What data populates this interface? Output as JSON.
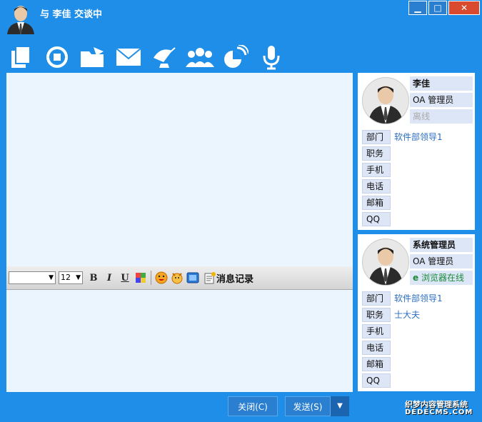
{
  "title": "与 李佳 交谈中",
  "window_buttons": {
    "minimize": "▁",
    "maximize": "□",
    "close": "✕"
  },
  "toolbar": [
    {
      "icon": "file-transfer-icon"
    },
    {
      "icon": "remote-assist-icon"
    },
    {
      "icon": "folder-share-icon"
    },
    {
      "icon": "mail-icon"
    },
    {
      "icon": "satellite-icon"
    },
    {
      "icon": "group-icon"
    },
    {
      "icon": "chart-icon"
    },
    {
      "icon": "microphone-icon"
    }
  ],
  "format_bar": {
    "font_value": "",
    "size_value": "12",
    "bold": "B",
    "italic": "I",
    "underline": "U",
    "history": "消息记录"
  },
  "contact": {
    "name": "李佳",
    "role": "OA 管理员",
    "status": "离线",
    "fields": [
      {
        "label": "部门",
        "value": "软件部领导1"
      },
      {
        "label": "职务",
        "value": ""
      },
      {
        "label": "手机",
        "value": ""
      },
      {
        "label": "电话",
        "value": ""
      },
      {
        "label": "邮箱",
        "value": ""
      },
      {
        "label": "QQ",
        "value": ""
      }
    ]
  },
  "self": {
    "name": "系统管理员",
    "role": "OA 管理员",
    "status": "浏览器在线",
    "fields": [
      {
        "label": "部门",
        "value": "软件部领导1"
      },
      {
        "label": "职务",
        "value": "士大夫"
      },
      {
        "label": "手机",
        "value": ""
      },
      {
        "label": "电话",
        "value": ""
      },
      {
        "label": "邮箱",
        "value": ""
      },
      {
        "label": "QQ",
        "value": ""
      }
    ]
  },
  "buttons": {
    "close": "关闭(C)",
    "send": "发送(S)",
    "dropdown": "▼"
  },
  "watermark": {
    "line1": "织梦内容管理系统",
    "line2": "DEDECMS.COM"
  }
}
